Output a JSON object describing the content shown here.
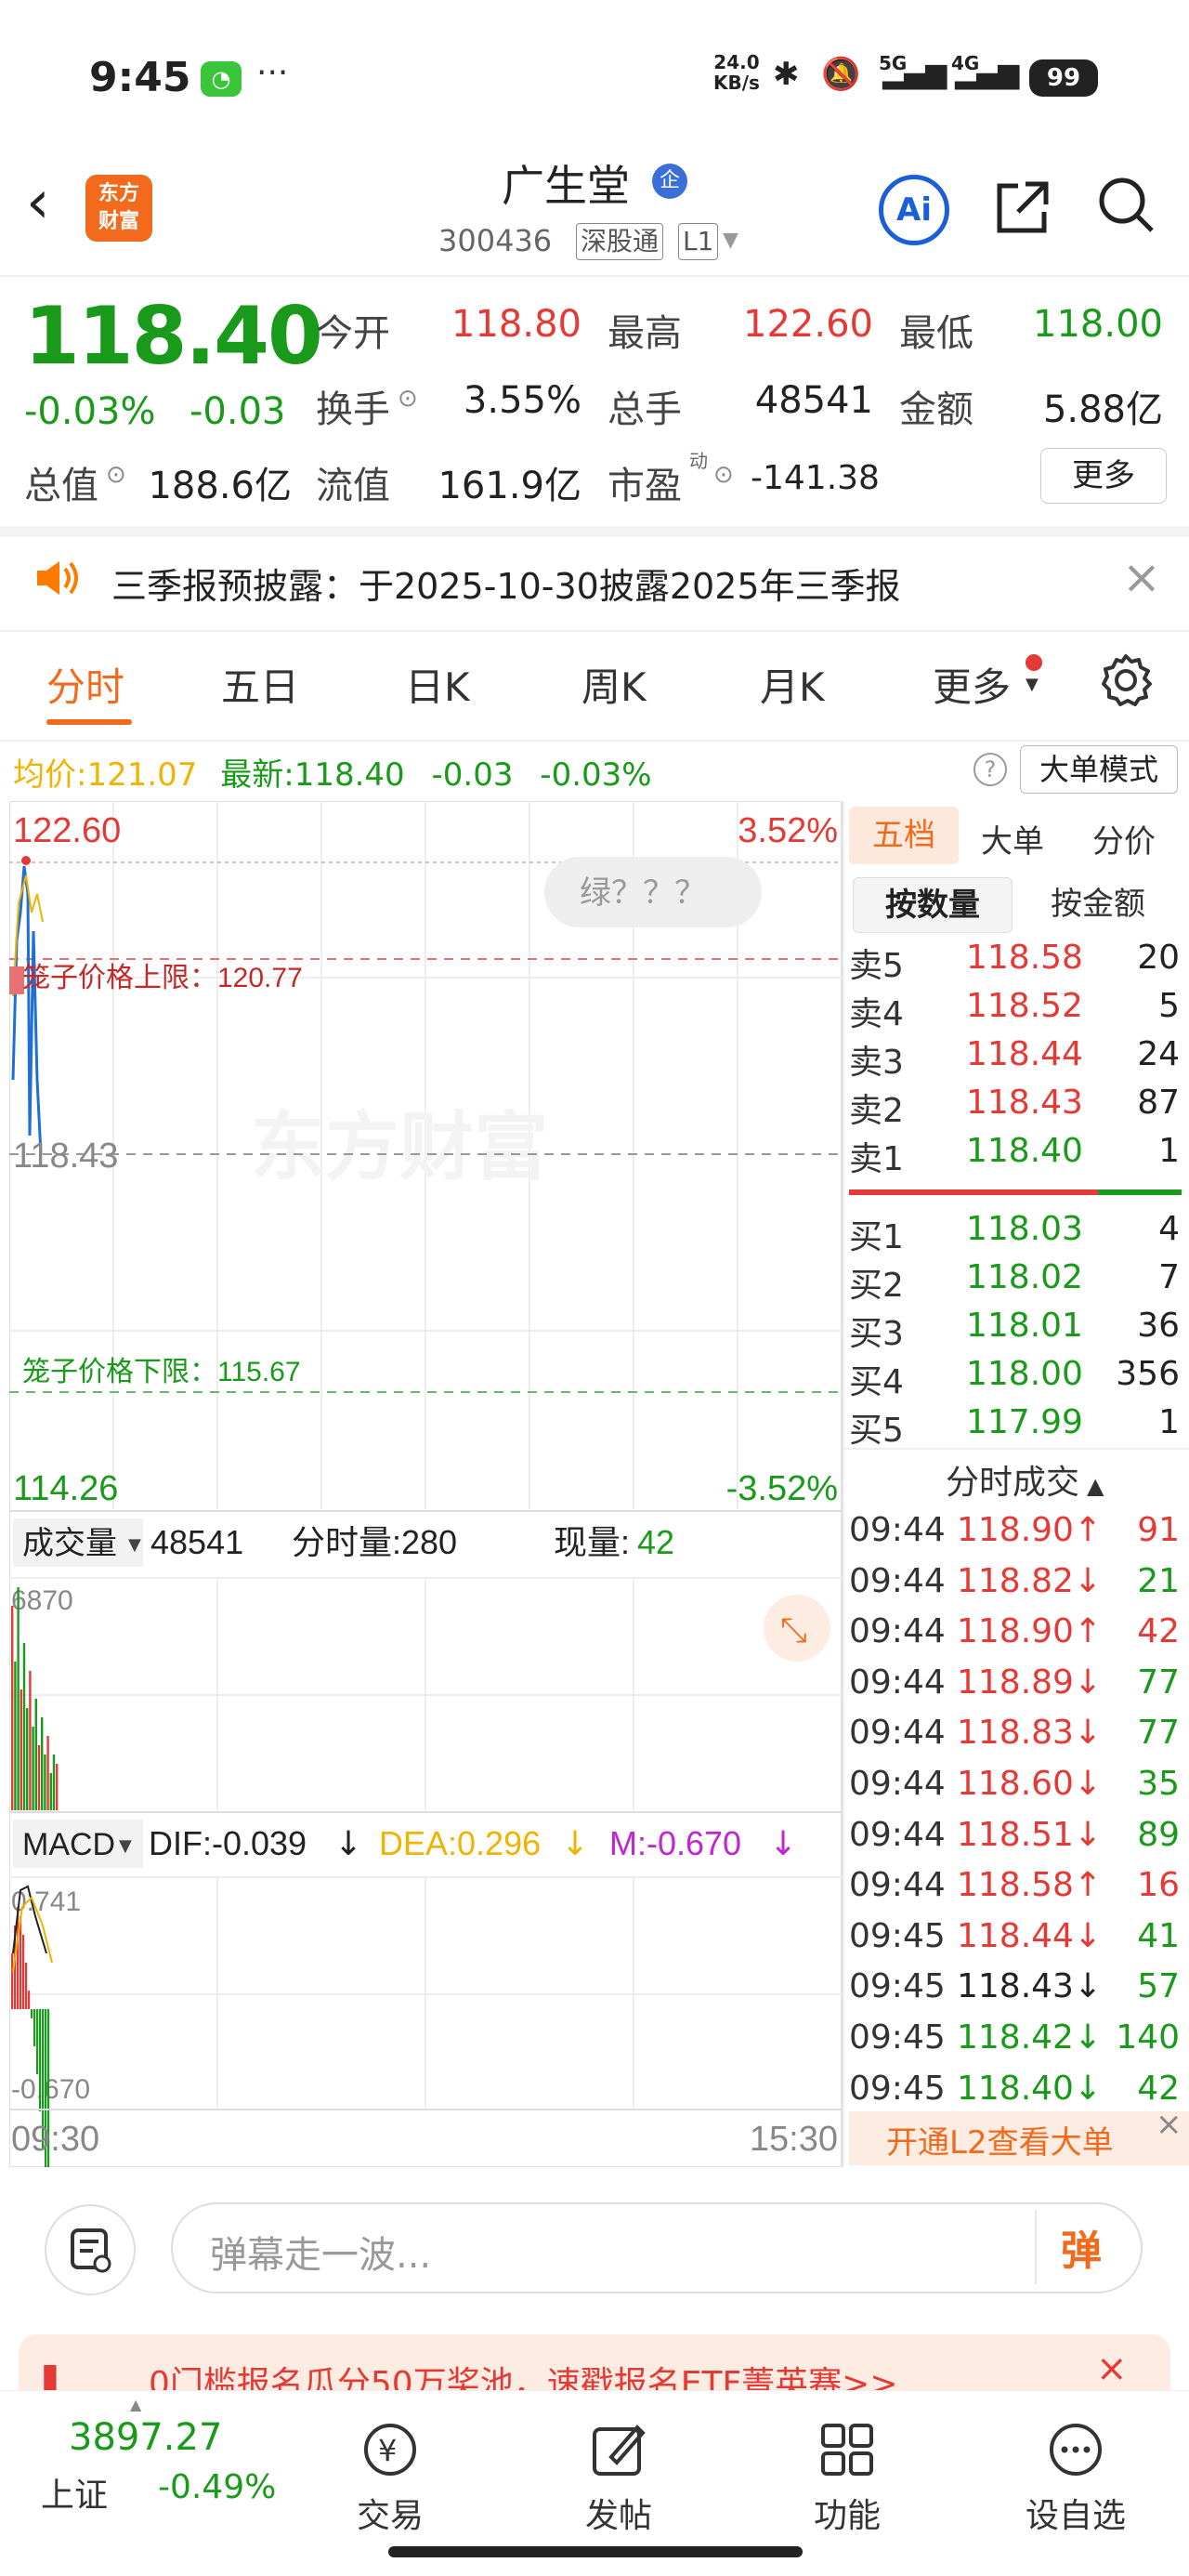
{
  "status": {
    "time": "9:45",
    "netspeed_value": "24.0",
    "netspeed_unit": "KB/s",
    "net1": "5G",
    "net2": "4G",
    "battery": "99"
  },
  "header": {
    "name": "广生堂",
    "enterprise_badge": "企",
    "code": "300436",
    "tag1": "深股通",
    "tag2": "L1",
    "logo_line1": "东方",
    "logo_line2": "财富",
    "ai_label": "Ai"
  },
  "quote": {
    "price": "118.40",
    "pct": "-0.03%",
    "chg": "-0.03",
    "open_label": "今开",
    "open": "118.80",
    "high_label": "最高",
    "high": "122.60",
    "low_label": "最低",
    "low": "118.00",
    "turnover_label": "换手",
    "turnover": "3.55%",
    "volume_label": "总手",
    "volume": "48541",
    "amount_label": "金额",
    "amount": "5.88亿",
    "mktcap_label": "总值",
    "mktcap": "188.6亿",
    "float_label": "流值",
    "float": "161.9亿",
    "pe_label": "市盈",
    "pe_sup": "动",
    "pe": "-141.38",
    "more": "更多"
  },
  "notice": {
    "text": "三季报预披露：于2025-10-30披露2025年三季报"
  },
  "tabs": [
    {
      "label": "分时"
    },
    {
      "label": "五日"
    },
    {
      "label": "日K"
    },
    {
      "label": "周K"
    },
    {
      "label": "月K"
    },
    {
      "label": "更多"
    }
  ],
  "avgline": {
    "avg_label": "均价:",
    "avg": "121.07",
    "latest_label": "最新:",
    "latest": "118.40",
    "chg": "-0.03",
    "pct": "-0.03%",
    "mode": "大单模式"
  },
  "chart": {
    "top_price": "122.60",
    "top_pct": "3.52%",
    "bottom_price": "114.26",
    "bottom_pct": "-3.52%",
    "prev_close": "118.43",
    "upper_limit_label": "笼子价格上限：120.77",
    "lower_limit_label": "笼子价格下限：115.67",
    "bubble": "绿？？？",
    "watermark": "东方财富",
    "vol_label": "成交量",
    "vol_total": "48541",
    "vol_min": "分时量:280",
    "vol_now_label": "现量:",
    "vol_now": "42",
    "vol_max": "6870",
    "macd_label": "MACD",
    "dif": "DIF:-0.039",
    "dea": "DEA:0.296",
    "m": "M:-0.670",
    "macd_top": "0.741",
    "macd_bottom": "-0.670",
    "time_start": "09:30",
    "time_end": "15:30"
  },
  "chart_data": {
    "type": "line",
    "y_range": [
      114.26,
      122.6
    ],
    "prev_close": 118.43,
    "series": [
      {
        "values": [
          118.8,
          121.5,
          122.6,
          120.0,
          121.2,
          119.6,
          118.4
        ]
      }
    ]
  },
  "orderbook": {
    "tabs": [
      "五档",
      "大单",
      "分价"
    ],
    "sub_qty": "按数量",
    "sub_amt": "按金额",
    "asks": [
      {
        "label": "卖5",
        "price": "118.58",
        "vol": "20"
      },
      {
        "label": "卖4",
        "price": "118.52",
        "vol": "5"
      },
      {
        "label": "卖3",
        "price": "118.44",
        "vol": "24"
      },
      {
        "label": "卖2",
        "price": "118.43",
        "vol": "87"
      },
      {
        "label": "卖1",
        "price": "118.40",
        "vol": "1"
      }
    ],
    "bids": [
      {
        "label": "买1",
        "price": "118.03",
        "vol": "4"
      },
      {
        "label": "买2",
        "price": "118.02",
        "vol": "7"
      },
      {
        "label": "买3",
        "price": "118.01",
        "vol": "36"
      },
      {
        "label": "买4",
        "price": "118.00",
        "vol": "356"
      },
      {
        "label": "买5",
        "price": "117.99",
        "vol": "1"
      }
    ]
  },
  "ticks": {
    "title": "分时成交",
    "rows": [
      {
        "time": "09:44",
        "price": "118.90↑",
        "vol": "91",
        "pc": "#e53935",
        "vc": "#e53935"
      },
      {
        "time": "09:44",
        "price": "118.82↓",
        "vol": "21",
        "pc": "#e53935",
        "vc": "#1a9a1a"
      },
      {
        "time": "09:44",
        "price": "118.90↑",
        "vol": "42",
        "pc": "#e53935",
        "vc": "#e53935"
      },
      {
        "time": "09:44",
        "price": "118.89↓",
        "vol": "77",
        "pc": "#e53935",
        "vc": "#1a9a1a"
      },
      {
        "time": "09:44",
        "price": "118.83↓",
        "vol": "77",
        "pc": "#e53935",
        "vc": "#1a9a1a"
      },
      {
        "time": "09:44",
        "price": "118.60↓",
        "vol": "35",
        "pc": "#e53935",
        "vc": "#1a9a1a"
      },
      {
        "time": "09:44",
        "price": "118.51↓",
        "vol": "89",
        "pc": "#e53935",
        "vc": "#1a9a1a"
      },
      {
        "time": "09:44",
        "price": "118.58↑",
        "vol": "16",
        "pc": "#e53935",
        "vc": "#e53935"
      },
      {
        "time": "09:45",
        "price": "118.44↓",
        "vol": "41",
        "pc": "#e53935",
        "vc": "#1a9a1a"
      },
      {
        "time": "09:45",
        "price": "118.43↓",
        "vol": "57",
        "pc": "#222222",
        "vc": "#1a9a1a"
      },
      {
        "time": "09:45",
        "price": "118.42↓",
        "vol": "140",
        "pc": "#1a9a1a",
        "vc": "#1a9a1a"
      },
      {
        "time": "09:45",
        "price": "118.40↓",
        "vol": "42",
        "pc": "#1a9a1a",
        "vc": "#1a9a1a"
      }
    ],
    "l2_banner": "开通L2查看大单"
  },
  "comment": {
    "placeholder": "弹幕走一波...",
    "send": "弹"
  },
  "promo": {
    "text": "0门槛报名瓜分50万奖池，速戳报名ETF菁英赛>>"
  },
  "bottom": {
    "index_value": "3897.27",
    "index_name": "上证",
    "index_pct": "-0.49%",
    "nav": [
      {
        "label": "交易"
      },
      {
        "label": "发帖"
      },
      {
        "label": "功能"
      },
      {
        "label": "设自选"
      }
    ]
  },
  "colors": {
    "up": "#e53935",
    "down": "#1a9a1a",
    "accent": "#f26b1d",
    "avg": "#f0b400"
  }
}
